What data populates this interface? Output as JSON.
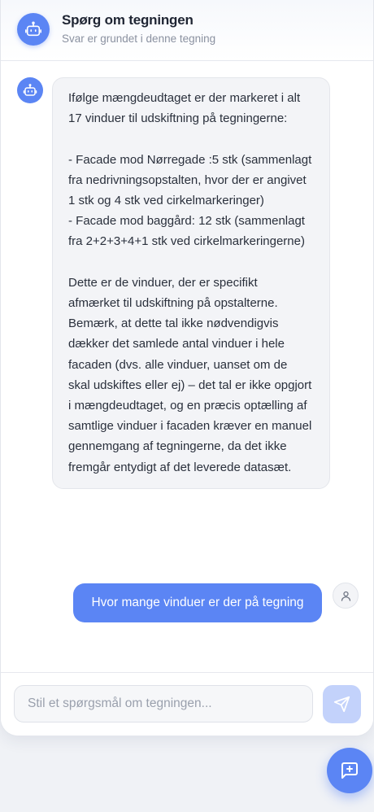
{
  "header": {
    "title": "Spørg om tegningen",
    "subtitle": "Svar er grundet i denne tegning",
    "avatar_icon": "robot-icon"
  },
  "messages": [
    {
      "role": "assistant",
      "avatar_icon": "robot-icon",
      "text": "Ifølge mængdeudtaget er der markeret i alt 17 vinduer til udskiftning på tegningerne:\n\n- Facade mod Nørregade :5 stk (sammenlagt fra nedrivningsopstalten, hvor der er angivet 1 stk og 4 stk ved cirkelmarkeringer)\n- Facade mod baggård: 12 stk (sammenlagt fra 2+2+3+4+1 stk ved cirkelmarkeringerne)\n\nDette er de vinduer, der er specifikt afmærket til udskiftning på opstalterne. Bemærk, at dette tal ikke nødvendigvis dækker det samlede antal vinduer i hele facaden (dvs. alle vinduer, uanset om de skal udskiftes eller ej) – det tal er ikke opgjort i mængdeudtaget, og en præcis optælling af samtlige vinduer i facaden kræver en manuel gennemgang af tegningerne, da det ikke fremgår entydigt af det leverede datasæt."
    },
    {
      "role": "user",
      "avatar_icon": "user-icon",
      "text": "Hvor mange vinduer er der på tegning"
    }
  ],
  "composer": {
    "placeholder": "Stil et spørgsmål om tegningen...",
    "value": "",
    "send_icon": "send-icon"
  },
  "fab": {
    "icon": "chat-add-icon"
  },
  "colors": {
    "accent": "#5b85f4",
    "send_disabled": "#c3d2fb",
    "bubble_bg": "#f3f4f7",
    "page_bg": "#f0f2f6"
  }
}
